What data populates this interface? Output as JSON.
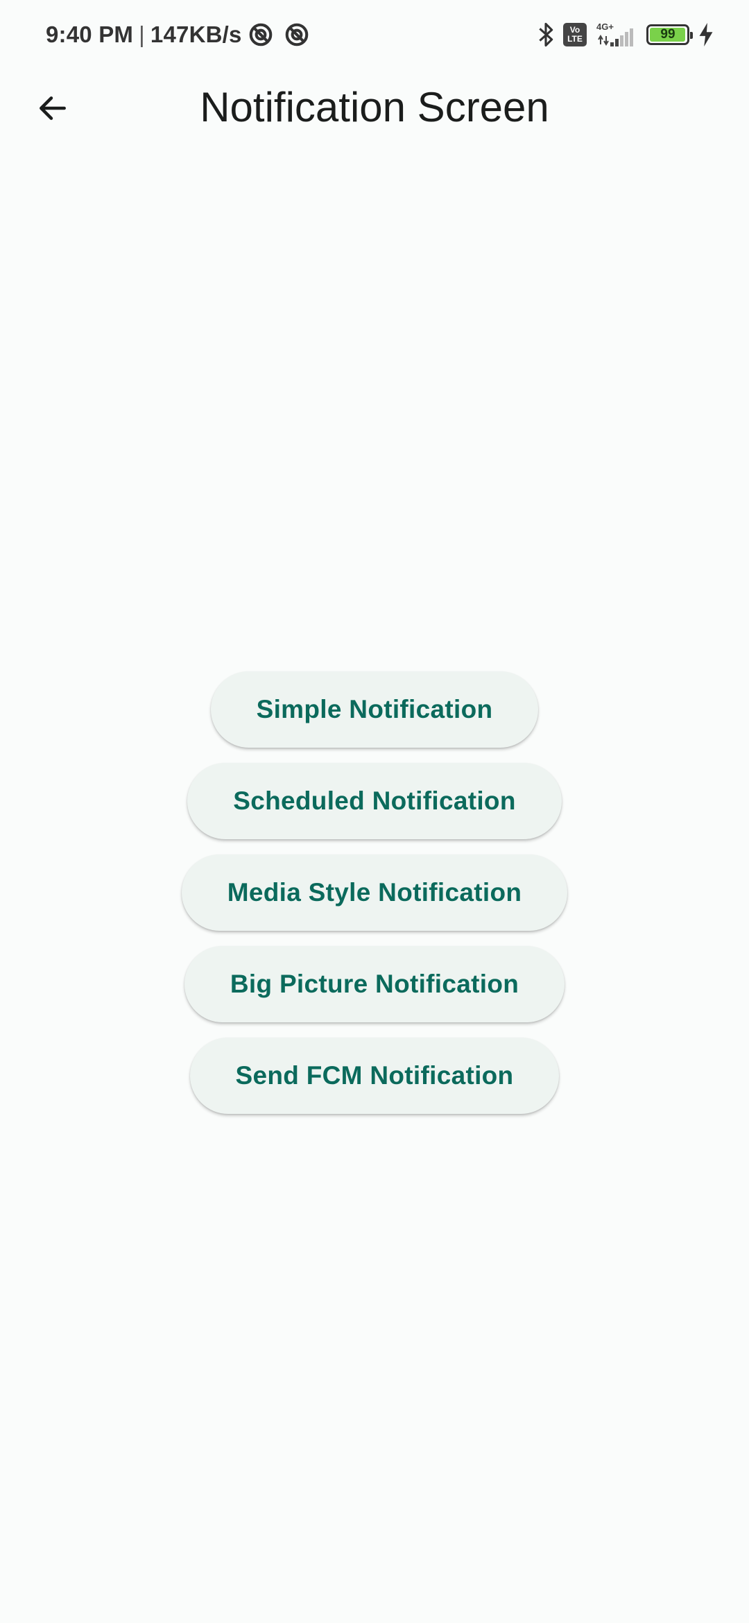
{
  "status_bar": {
    "time": "9:40 PM",
    "separator": "|",
    "net_speed": "147KB/s",
    "volte_top": "Vo",
    "volte_bottom": "LTE",
    "network_gen": "4G+",
    "battery_level": "99",
    "battery_fraction": 0.99,
    "battery_color": "#7ad14a",
    "icons": [
      "sync-off-icon",
      "sync-off-icon",
      "bluetooth-icon",
      "volte-icon",
      "signal-icon",
      "battery-icon",
      "charging-icon"
    ]
  },
  "app_bar": {
    "back_icon": "arrow-left-icon",
    "title": "Notification Screen"
  },
  "buttons": [
    {
      "label": "Simple Notification"
    },
    {
      "label": "Scheduled Notification"
    },
    {
      "label": "Media Style Notification"
    },
    {
      "label": "Big Picture Notification"
    },
    {
      "label": "Send FCM Notification"
    }
  ],
  "colors": {
    "background": "#fafcfb",
    "button_bg": "#eef4f1",
    "button_text": "#0b6a5c"
  }
}
